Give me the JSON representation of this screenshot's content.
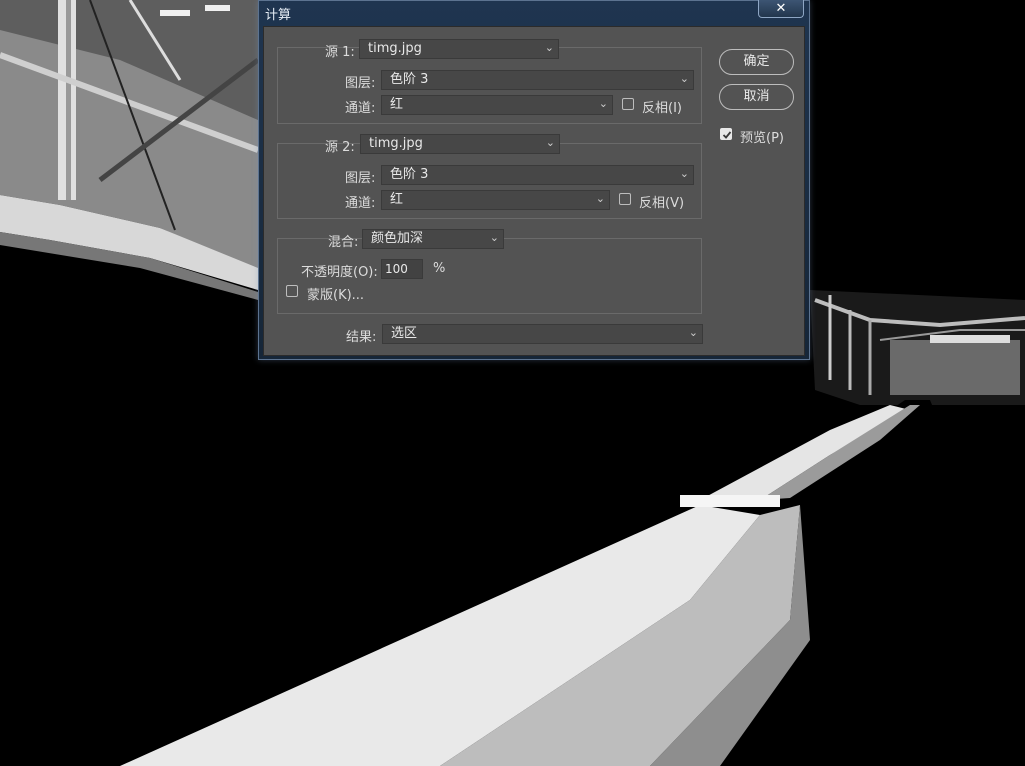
{
  "window": {
    "title": "计算",
    "close_glyph": "✕"
  },
  "source1": {
    "label": "源 1:",
    "file": "timg.jpg",
    "layer_label": "图层:",
    "layer": "色阶 3",
    "channel_label": "通道:",
    "channel": "红",
    "invert_label": "反相(I)",
    "invert_checked": false
  },
  "source2": {
    "label": "源 2:",
    "file": "timg.jpg",
    "layer_label": "图层:",
    "layer": "色阶 3",
    "channel_label": "通道:",
    "channel": "红",
    "invert_label": "反相(V)",
    "invert_checked": false
  },
  "blend": {
    "label": "混合:",
    "mode": "颜色加深",
    "opacity_label": "不透明度(O):",
    "opacity": "100",
    "percent": "%",
    "mask_label": "蒙版(K)...",
    "mask_checked": false
  },
  "result": {
    "label": "结果:",
    "value": "选区"
  },
  "buttons": {
    "ok": "确定",
    "cancel": "取消"
  },
  "preview": {
    "label": "预览(P)",
    "checked": true
  },
  "icons": {
    "dropdown": "chevron-down-icon",
    "close": "close-icon",
    "check": "check-icon"
  },
  "colors": {
    "panel": "#535353",
    "titlebar": "#1f3550",
    "text": "#dcdcdc"
  }
}
